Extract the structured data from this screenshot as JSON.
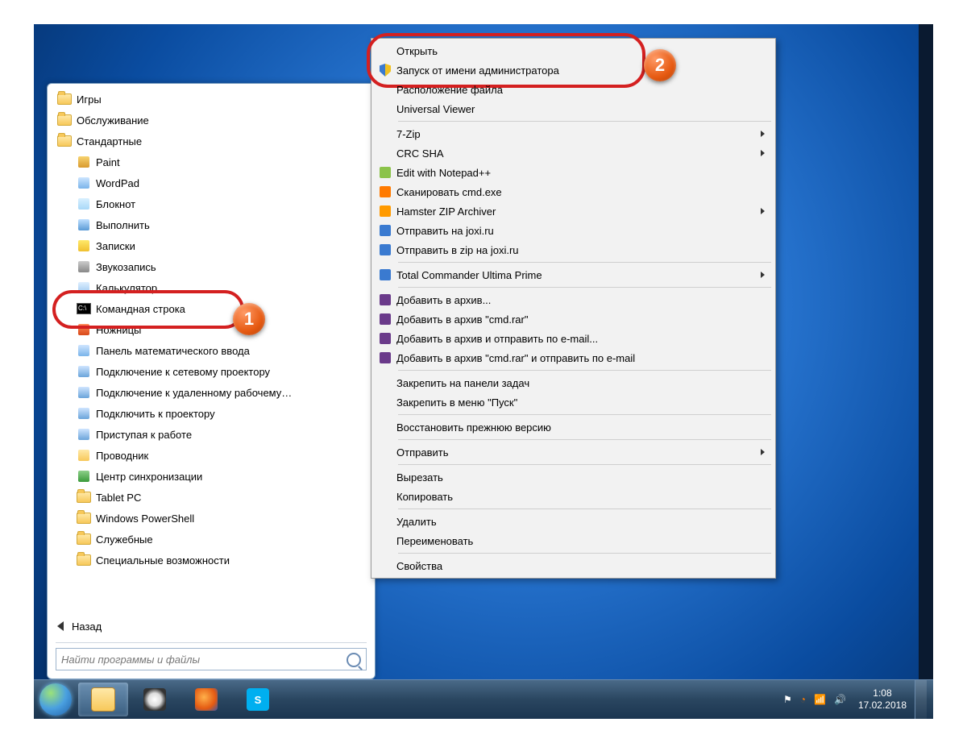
{
  "start_menu": {
    "folders_top": [
      {
        "label": "Игры"
      },
      {
        "label": "Обслуживание"
      },
      {
        "label": "Стандартные"
      }
    ],
    "accessories": [
      {
        "label": "Paint",
        "icon": "paint"
      },
      {
        "label": "WordPad",
        "icon": "wordpad"
      },
      {
        "label": "Блокнот",
        "icon": "notepad"
      },
      {
        "label": "Выполнить",
        "icon": "run"
      },
      {
        "label": "Записки",
        "icon": "sticky"
      },
      {
        "label": "Звукозапись",
        "icon": "mic"
      },
      {
        "label": "Калькулятор",
        "icon": "calc"
      },
      {
        "label": "Командная строка",
        "icon": "cmd",
        "highlight": true
      },
      {
        "label": "Ножницы",
        "icon": "snip"
      },
      {
        "label": "Панель математического ввода",
        "icon": "math"
      },
      {
        "label": "Подключение к сетевому проектору",
        "icon": "netproj"
      },
      {
        "label": "Подключение к удаленному рабочему…",
        "icon": "rdp"
      },
      {
        "label": "Подключить к проектору",
        "icon": "proj"
      },
      {
        "label": "Приступая к работе",
        "icon": "getting"
      },
      {
        "label": "Проводник",
        "icon": "explorer"
      },
      {
        "label": "Центр синхронизации",
        "icon": "sync"
      }
    ],
    "sub_folders": [
      {
        "label": "Tablet PC"
      },
      {
        "label": "Windows PowerShell"
      },
      {
        "label": "Служебные"
      },
      {
        "label": "Специальные возможности"
      }
    ],
    "back_label": "Назад",
    "search_placeholder": "Найти программы и файлы"
  },
  "context_menu": {
    "groups": [
      [
        {
          "label": "Открыть",
          "icon": ""
        },
        {
          "label": "Запуск от имени администратора",
          "icon": "shield",
          "highlight": true
        },
        {
          "label": "Расположение файла",
          "icon": ""
        },
        {
          "label": "Universal Viewer",
          "icon": ""
        }
      ],
      [
        {
          "label": "7-Zip",
          "submenu": true
        },
        {
          "label": "CRC SHA",
          "submenu": true
        },
        {
          "label": "Edit with Notepad++",
          "icon": "npp"
        },
        {
          "label": "Сканировать cmd.exe",
          "icon": "avast"
        },
        {
          "label": "Hamster ZIP Archiver",
          "icon": "hamster",
          "submenu": true
        },
        {
          "label": "Отправить на joxi.ru",
          "icon": "joxi"
        },
        {
          "label": "Отправить в zip на joxi.ru",
          "icon": "joxi"
        }
      ],
      [
        {
          "label": "Total Commander Ultima Prime",
          "icon": "tc",
          "submenu": true
        }
      ],
      [
        {
          "label": "Добавить в архив...",
          "icon": "rar"
        },
        {
          "label": "Добавить в архив \"cmd.rar\"",
          "icon": "rar"
        },
        {
          "label": "Добавить в архив и отправить по e-mail...",
          "icon": "rar"
        },
        {
          "label": "Добавить в архив \"cmd.rar\" и отправить по e-mail",
          "icon": "rar"
        }
      ],
      [
        {
          "label": "Закрепить на панели задач"
        },
        {
          "label": "Закрепить в меню \"Пуск\""
        }
      ],
      [
        {
          "label": "Восстановить прежнюю версию"
        }
      ],
      [
        {
          "label": "Отправить",
          "submenu": true
        }
      ],
      [
        {
          "label": "Вырезать"
        },
        {
          "label": "Копировать"
        }
      ],
      [
        {
          "label": "Удалить"
        },
        {
          "label": "Переименовать"
        }
      ],
      [
        {
          "label": "Свойства"
        }
      ]
    ]
  },
  "badges": {
    "one": "1",
    "two": "2"
  },
  "tray": {
    "time": "1:08",
    "date": "17.02.2018"
  }
}
